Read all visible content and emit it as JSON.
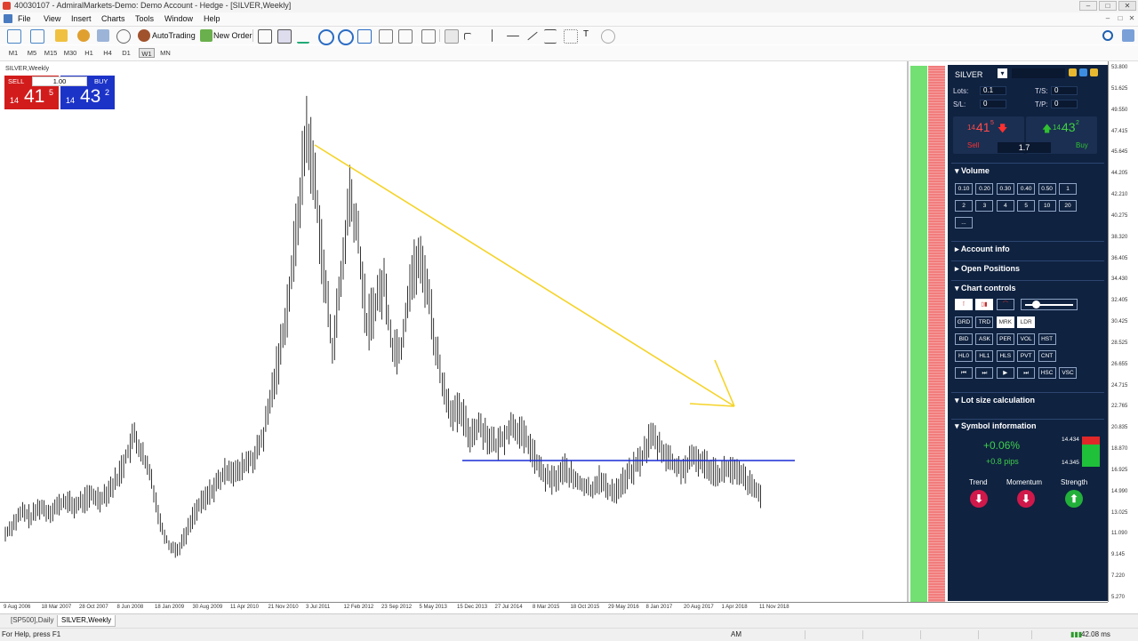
{
  "window": {
    "title": "40030107 - AdmiralMarkets-Demo: Demo Account - Hedge - [SILVER,Weekly]",
    "controls": [
      "–",
      "□",
      "✕"
    ],
    "mdi_controls": [
      "–",
      "□",
      "✕"
    ]
  },
  "menu": [
    "File",
    "View",
    "Insert",
    "Charts",
    "Tools",
    "Window",
    "Help"
  ],
  "toolbar": {
    "autotrading": "AutoTrading",
    "new_order": "New Order"
  },
  "timeframes": [
    "M1",
    "M5",
    "M15",
    "M30",
    "H1",
    "H4",
    "D1",
    "W1",
    "MN"
  ],
  "active_timeframe": "W1",
  "chart": {
    "label": "SILVER,Weekly",
    "sell": {
      "label": "SELL",
      "prefix": "14",
      "big": "41",
      "sup": "5"
    },
    "buy": {
      "label": "BUY",
      "prefix": "14",
      "big": "43",
      "sup": "2"
    },
    "lot": "1.00",
    "y_ticks": [
      "53.800",
      "51.625",
      "49.550",
      "47.415",
      "45.645",
      "44.205",
      "42.210",
      "40.275",
      "38.320",
      "36.405",
      "34.430",
      "32.405",
      "30.425",
      "28.525",
      "26.655",
      "24.715",
      "22.765",
      "20.835",
      "18.870",
      "16.925",
      "14.990",
      "13.025",
      "11.090",
      "9.145",
      "7.220",
      "5.270"
    ],
    "x_ticks": [
      "9 Aug 2006",
      "18 Mar 2007",
      "28 Oct 2007",
      "8 Jun 2008",
      "18 Jan 2009",
      "30 Aug 2009",
      "11 Apr 2010",
      "21 Nov 2010",
      "3 Jul 2011",
      "12 Feb 2012",
      "23 Sep 2012",
      "5 May 2013",
      "15 Dec 2013",
      "27 Jul 2014",
      "8 Mar 2015",
      "18 Oct 2015",
      "29 May 2016",
      "8 Jan 2017",
      "20 Aug 2017",
      "1 Apr 2018",
      "11 Nov 2018"
    ],
    "colors": {
      "trendline": "#f5d327",
      "support": "#1a2bd6",
      "candles": "#000000"
    }
  },
  "chart_data": {
    "type": "line",
    "series": [
      {
        "values": [
          11,
          12,
          13,
          12.5,
          13.5,
          13,
          13.5,
          14,
          13.5,
          14,
          14.5,
          14.2,
          15,
          16,
          18,
          20,
          18,
          16,
          12,
          10,
          9.5,
          11,
          13,
          14,
          15,
          16,
          17,
          16.5,
          17.5,
          18,
          20,
          24,
          28,
          33,
          40,
          48,
          43,
          35,
          28,
          34,
          42,
          38,
          30,
          32,
          34,
          28,
          28,
          34,
          36,
          34,
          28,
          24,
          22,
          22,
          20,
          21,
          20,
          19,
          20,
          21,
          20,
          19,
          17,
          16,
          16,
          17,
          16,
          15.5,
          15,
          16,
          15,
          15,
          16,
          17,
          18,
          20,
          19,
          18,
          17,
          17,
          18,
          17.5,
          17,
          16.5,
          17,
          16.5,
          16,
          15,
          14.5
        ]
      }
    ],
    "y_range": [
      5.27,
      53.8
    ]
  },
  "panel": {
    "symbol": "SILVER",
    "lots_label": "Lots:",
    "lots_value": "0.1",
    "ts_label": "T/S:",
    "ts_value": "0",
    "sl_label": "S/L:",
    "sl_value": "0",
    "tp_label": "T/P:",
    "tp_value": "0",
    "sell_price_prefix": "14.",
    "sell_price_big": "41",
    "sell_price_sup": "5",
    "buy_price_prefix": "14.",
    "buy_price_big": "43",
    "buy_price_sup": "2",
    "sell_label": "Sell",
    "buy_label": "Buy",
    "spread": "1.7",
    "volume": {
      "title": "Volume",
      "row1": [
        "0.10",
        "0.20",
        "0.30",
        "0.40",
        "0.50",
        "1"
      ],
      "row2": [
        "2",
        "3",
        "4",
        "5",
        "10",
        "20"
      ],
      "row3": [
        "..."
      ]
    },
    "account_info": "Account info",
    "open_positions": "Open Positions",
    "chart_controls": {
      "title": "Chart controls",
      "row1": [
        "GRD",
        "TRD",
        "MRK",
        "LDR"
      ],
      "row2": [
        "BID",
        "ASK",
        "PER",
        "VOL",
        "HST"
      ],
      "row3": [
        "HL0",
        "HL1",
        "HLS",
        "PVT",
        "CNT"
      ],
      "row4": [
        "⏮",
        "⏭",
        "▶",
        "⏭",
        "HSC",
        "VSC"
      ]
    },
    "lot_size": "Lot size calculation",
    "symbol_info": {
      "title": "Symbol information",
      "change_pct": "+0.06%",
      "change_pips": "+0.8 pips",
      "high": "14.434",
      "low": "14.345",
      "labels": [
        "Trend",
        "Momentum",
        "Strength"
      ],
      "directions": [
        "down",
        "down",
        "up"
      ]
    }
  },
  "tabs": [
    "[SP500],Daily",
    "SILVER,Weekly"
  ],
  "status": {
    "help": "For Help, press F1",
    "ampm": "AM",
    "traffic": "42.08 ms"
  }
}
